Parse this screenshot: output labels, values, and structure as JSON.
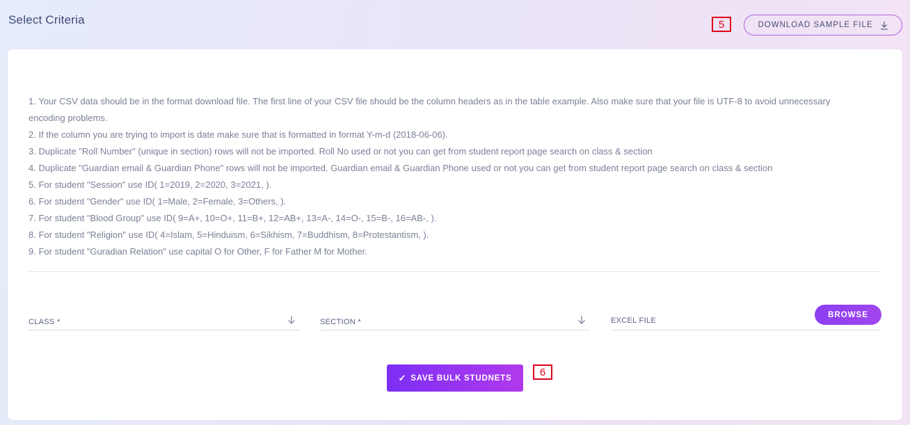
{
  "header": {
    "title": "Select Criteria",
    "download_label": "DOWNLOAD SAMPLE FILE",
    "marker_5": "5"
  },
  "instructions": [
    "1. Your CSV data should be in the format download file. The first line of your CSV file should be the column headers as in the table example. Also make sure that your file is UTF-8 to avoid unnecessary encoding problems.",
    "2. If the column you are trying to import is date make sure that is formatted in format Y-m-d (2018-06-06).",
    "3. Duplicate \"Roll Number\" (unique in section) rows will not be imported. Roll No used or not you can get from student report page search on class & section",
    "4. Duplicate \"Guardian email & Guardian Phone\" rows will not be imported. Guardian email & Guardian Phone used or not you can get from student report page search on class & section",
    "5. For student \"Session\" use ID( 1=2019, 2=2020, 3=2021, ).",
    "6. For student \"Gender\" use ID( 1=Male, 2=Female, 3=Others, ).",
    "7. For student \"Blood Group\" use ID( 9=A+, 10=O+, 11=B+, 12=AB+, 13=A-, 14=O-, 15=B-, 16=AB-, ).",
    "8. For student \"Religion\" use ID( 4=Islam, 5=Hinduism, 6=Sikhism, 7=Buddhism, 8=Protestantism, ).",
    "9. For student \"Guradian Relation\" use capital O for Other, F for Father M for Mother."
  ],
  "form": {
    "class_label": "CLASS *",
    "section_label": "SECTION *",
    "excel_label": "EXCEL FILE",
    "browse_label": "BROWSE",
    "save_label": "SAVE BULK STUDNETS",
    "marker_6": "6"
  },
  "icons": {
    "download": "download-icon",
    "dropdown": "arrow-down-icon",
    "check": "check-icon"
  },
  "colors": {
    "accent": "#8b3ef2",
    "marker": "#e0001b"
  }
}
